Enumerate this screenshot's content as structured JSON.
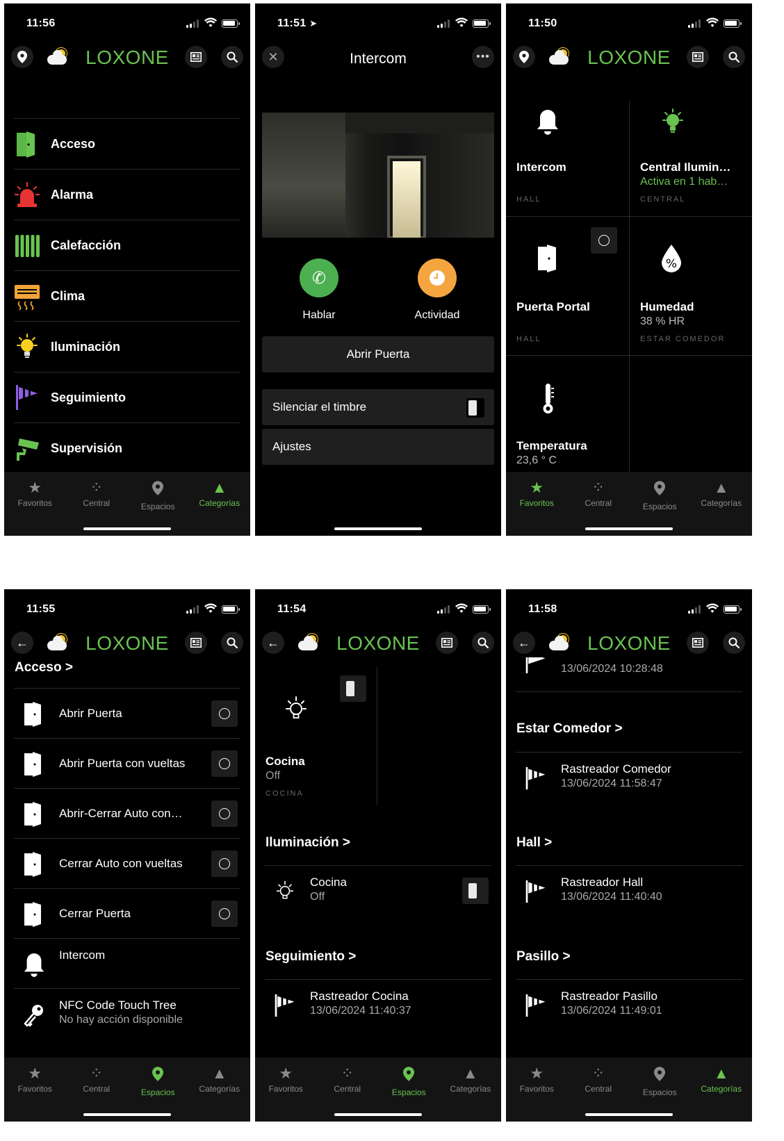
{
  "statusbar": {
    "s1_time": "11:56",
    "s2_time": "11:51",
    "s3_time": "11:50",
    "s4_time": "11:55",
    "s5_time": "11:54",
    "s6_time": "11:58"
  },
  "brand": {
    "logo": "LOXONE",
    "accent": "#69c350"
  },
  "tabs": {
    "favoritos": "Favoritos",
    "central": "Central",
    "espacios": "Espacios",
    "categorias": "Categorías"
  },
  "categories": {
    "items": [
      {
        "label": "Acceso",
        "icon": "door-icon"
      },
      {
        "label": "Alarma",
        "icon": "alarm-siren-icon"
      },
      {
        "label": "Calefacción",
        "icon": "radiator-icon"
      },
      {
        "label": "Clima",
        "icon": "air-conditioner-icon"
      },
      {
        "label": "Iluminación",
        "icon": "lightbulb-icon"
      },
      {
        "label": "Seguimiento",
        "icon": "tracker-flag-icon"
      },
      {
        "label": "Supervisión",
        "icon": "security-camera-icon"
      }
    ]
  },
  "intercom": {
    "title": "Intercom",
    "talk": "Hablar",
    "activity": "Actividad",
    "open_door": "Abrir Puerta",
    "mute_bell": "Silenciar el timbre",
    "settings": "Ajustes"
  },
  "favorites": {
    "tiles": [
      {
        "name": "Intercom",
        "value": "",
        "room": "HALL",
        "icon": "bell-icon"
      },
      {
        "name": "Central Ilumin…",
        "value": "Activa en 1 hab…",
        "room": "CENTRAL",
        "icon": "lightbulb-icon"
      },
      {
        "name": "Puerta Portal",
        "value": "",
        "room": "HALL",
        "icon": "door-icon"
      },
      {
        "name": "Humedad",
        "value": "38 % HR",
        "room": "ESTAR COMEDOR",
        "icon": "humidity-icon"
      },
      {
        "name": "Temperatura",
        "value": "23,6 ° C",
        "room": "",
        "icon": "thermometer-icon"
      }
    ]
  },
  "acceso": {
    "heading": "Acceso >",
    "items": [
      {
        "name": "Abrir Puerta"
      },
      {
        "name": "Abrir Puerta con vueltas"
      },
      {
        "name": "Abrir-Cerrar Auto con…"
      },
      {
        "name": "Cerrar Auto con vueltas"
      },
      {
        "name": "Cerrar Puerta"
      },
      {
        "name": "Intercom"
      },
      {
        "name": "NFC Code Touch Tree",
        "value": "No hay acción disponible"
      }
    ]
  },
  "cocina_space": {
    "tile": {
      "name": "Cocina",
      "value": "Off",
      "room": "COCINA"
    },
    "iluminacion": "Iluminación >",
    "light": {
      "name": "Cocina",
      "value": "Off"
    },
    "seguimiento": "Seguimiento >",
    "tracker": {
      "name": "Rastreador Cocina",
      "value": "13/06/2024 11:40:37"
    }
  },
  "trackers": {
    "top_value": "13/06/2024 10:28:48",
    "estar": "Estar Comedor >",
    "comedor": {
      "name": "Rastreador Comedor",
      "value": "13/06/2024 11:58:47"
    },
    "hall_h": "Hall >",
    "hall": {
      "name": "Rastreador Hall",
      "value": "13/06/2024 11:40:40"
    },
    "pasillo_h": "Pasillo >",
    "pasillo": {
      "name": "Rastreador Pasillo",
      "value": "13/06/2024 11:49:01"
    }
  }
}
